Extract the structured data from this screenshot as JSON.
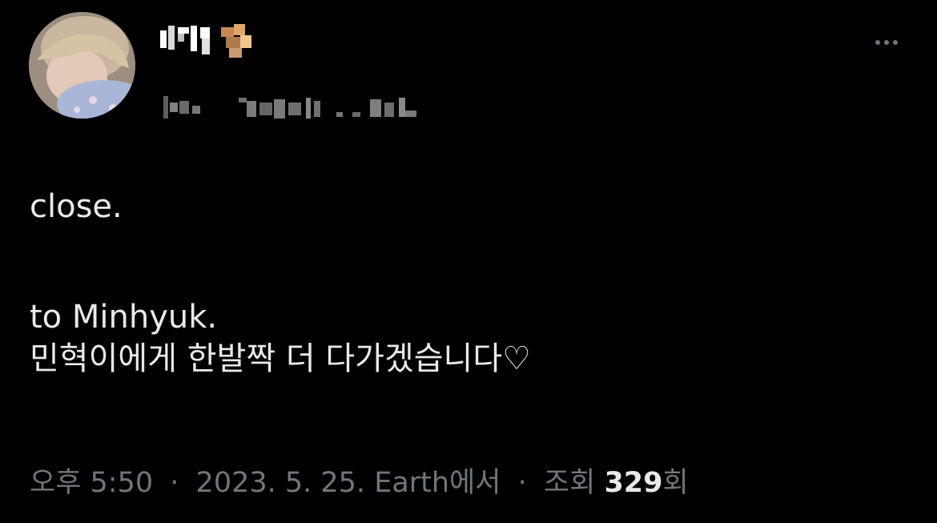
{
  "header": {
    "more_icon": "more-horizontal-icon"
  },
  "tweet": {
    "lines": [
      "close.",
      "to Minhyuk.",
      "민혁이에게 한발짝 더 다가겠습니다♡"
    ]
  },
  "meta": {
    "time": "오후 5:50",
    "date": "2023. 5. 25.",
    "source": "Earth에서",
    "views_label_prefix": "조회",
    "views_count": "329",
    "views_label_suffix": "회",
    "separator": "·"
  },
  "colors": {
    "background": "#000000",
    "primary_text": "#e7e9ea",
    "secondary_text": "#71767b"
  }
}
